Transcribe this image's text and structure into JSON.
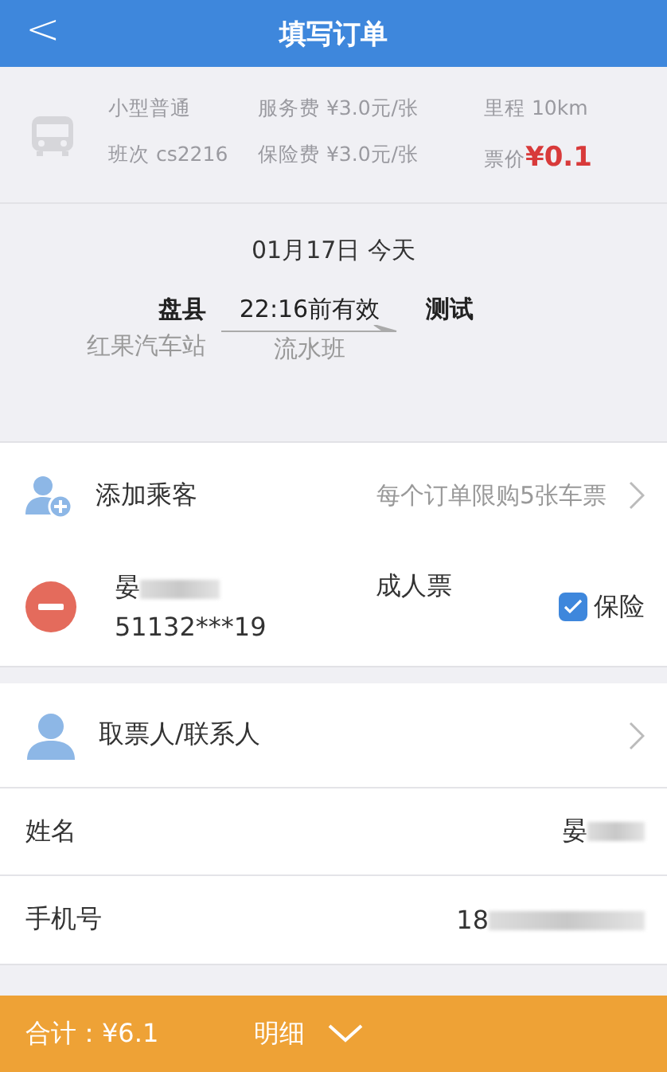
{
  "header": {
    "back_icon": "<",
    "title": "填写订单"
  },
  "trip_info": {
    "bus_type": "小型普通",
    "service_fee": "服务费 ¥3.0元/张",
    "distance": "里程 10km",
    "schedule": "班次 cs2216",
    "insurance_fee": "保险费 ¥3.0元/张",
    "price_label": "票价",
    "price": "¥0.1"
  },
  "route": {
    "date": "01月17日 今天",
    "origin": "盘县",
    "origin_station": "红果汽车站",
    "validity": "22:16前有效",
    "destination": "测试",
    "service_type": "流水班"
  },
  "add_passenger": {
    "label": "添加乘客",
    "hint": "每个订单限购5张车票"
  },
  "passengers": [
    {
      "name": "晏",
      "name_redacted": true,
      "id_number": "51132***19",
      "ticket_type": "成人票",
      "insurance_label": "保险",
      "insurance_checked": true
    }
  ],
  "contact": {
    "label": "取票人/联系人"
  },
  "contact_fields": [
    {
      "label": "姓名",
      "value": "晏",
      "redacted": true
    },
    {
      "label": "手机号",
      "value": "18",
      "redacted": true
    }
  ],
  "footer": {
    "total": "合计：¥6.1",
    "details": "明细"
  }
}
